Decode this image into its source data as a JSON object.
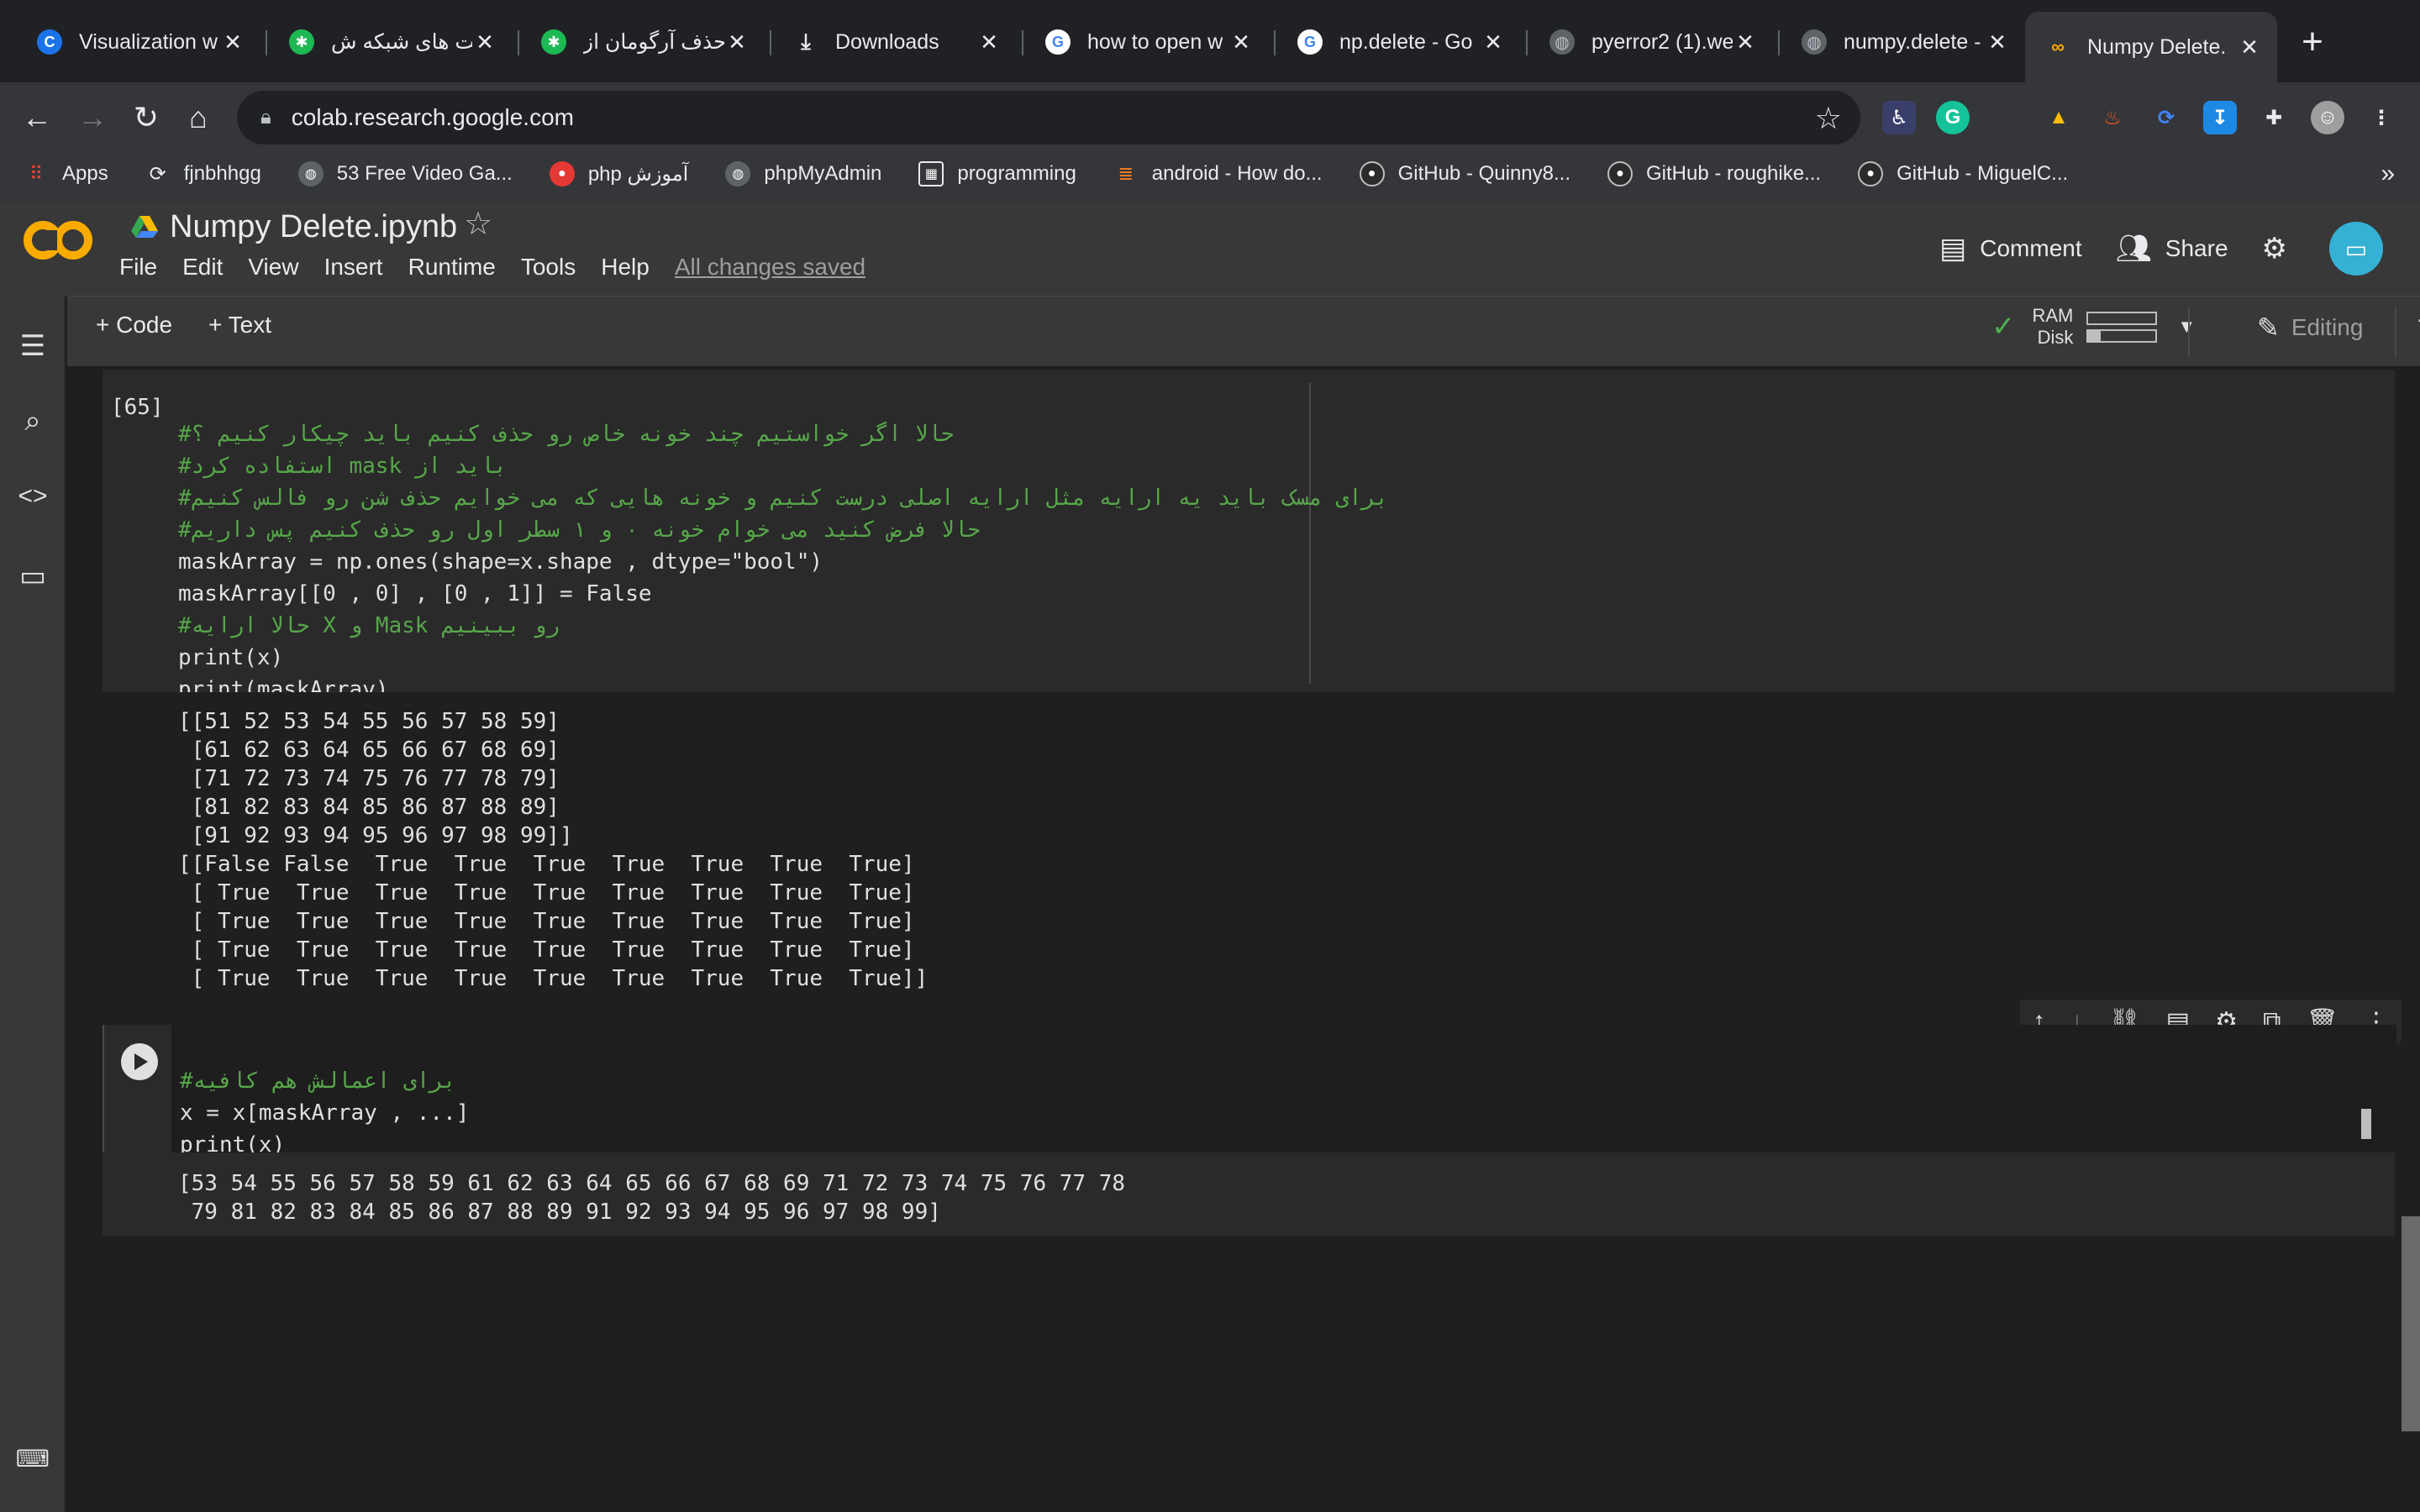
{
  "browser": {
    "tabs": [
      {
        "label": "Visualization w",
        "icon": "colab-c-icon",
        "color": "#1a73e8"
      },
      {
        "label": "فعالیت های شبکه ش",
        "icon": "green-flower-icon",
        "color": "#1db954"
      },
      {
        "label": "حذف آرگومان از py",
        "icon": "green-flower-icon",
        "color": "#1db954"
      },
      {
        "label": "Downloads",
        "icon": "download-icon",
        "color": "#e8eaed"
      },
      {
        "label": "how to open w",
        "icon": "google-g-icon",
        "color": "#ffffff"
      },
      {
        "label": "np.delete - Go",
        "icon": "google-g-icon",
        "color": "#ffffff"
      },
      {
        "label": "pyerror2 (1).we",
        "icon": "globe-icon",
        "color": "#9aa0a6"
      },
      {
        "label": "numpy.delete -",
        "icon": "globe-icon",
        "color": "#9aa0a6"
      },
      {
        "label": "Numpy Delete.",
        "icon": "colab-co-icon",
        "color": "#f9ab00",
        "active": true
      }
    ],
    "url": "colab.research.google.com",
    "bookmarks": [
      {
        "label": "Apps",
        "icon": "apps-grid-icon"
      },
      {
        "label": "fjnbhhgg",
        "icon": "github-icon"
      },
      {
        "label": "53 Free Video Ga...",
        "icon": "globe-icon"
      },
      {
        "label": "php آموزش",
        "icon": "tomato-icon"
      },
      {
        "label": "phpMyAdmin",
        "icon": "globe-icon"
      },
      {
        "label": "programming",
        "icon": "folder-icon"
      },
      {
        "label": "android - How do...",
        "icon": "stackoverflow-icon"
      },
      {
        "label": "GitHub - Quinny8...",
        "icon": "github-icon"
      },
      {
        "label": "GitHub - roughike...",
        "icon": "github-icon"
      },
      {
        "label": "GitHub - MiguelC...",
        "icon": "github-icon"
      }
    ],
    "bookmarks_more": "»"
  },
  "colab": {
    "logo": "CO",
    "title": "Numpy Delete.ipynb",
    "menus": [
      "File",
      "Edit",
      "View",
      "Insert",
      "Runtime",
      "Tools",
      "Help"
    ],
    "save_status": "All changes saved",
    "comment_label": "Comment",
    "share_label": "Share",
    "add_code": "+ Code",
    "add_text": "+ Text",
    "ram_label": "RAM",
    "disk_label": "Disk",
    "ram_usage": 0.0,
    "disk_usage": 0.18,
    "editing_label": "Editing"
  },
  "cells": {
    "cell1": {
      "exec_count": "[65]",
      "lines": [
        {
          "type": "comment",
          "text": "#حالا اگر خواستیم چند خونه خاص رو حذف کنیم باید چیکار کنیم ؟"
        },
        {
          "type": "comment",
          "text": "#استفاده کرد mask باید از"
        },
        {
          "type": "comment",
          "text": "#برای مسک باید یه ارایه مثل ارایه اصلی درست کنیم و خونه هایی که می خوایم حذف شن رو فالس کنیم"
        },
        {
          "type": "comment",
          "text": "#حالا فرض کنید می خوام خونه ۰ و ۱ سطر اول رو حذف کنیم پس داریم"
        },
        {
          "type": "code",
          "text": "maskArray = np.ones(shape=x.shape , dtype=\"bool\")"
        },
        {
          "type": "code",
          "text": "maskArray[[0 , 0] , [0 , 1]] = False"
        },
        {
          "type": "comment",
          "text": "#حالا ارایه X و Mask رو ببینیم"
        },
        {
          "type": "code",
          "text": "print(x)"
        },
        {
          "type": "code",
          "text": "print(maskArray)"
        }
      ],
      "output": "[[51 52 53 54 55 56 57 58 59]\n [61 62 63 64 65 66 67 68 69]\n [71 72 73 74 75 76 77 78 79]\n [81 82 83 84 85 86 87 88 89]\n [91 92 93 94 95 96 97 98 99]]\n[[False False  True  True  True  True  True  True  True]\n [ True  True  True  True  True  True  True  True  True]\n [ True  True  True  True  True  True  True  True  True]\n [ True  True  True  True  True  True  True  True  True]\n [ True  True  True  True  True  True  True  True  True]]"
    },
    "cell2": {
      "lines": [
        {
          "type": "comment",
          "text": "#برای اعمالش هم کافیه"
        },
        {
          "type": "code",
          "text": "x = x[maskArray , ...]"
        },
        {
          "type": "code",
          "text": "print(x)"
        }
      ],
      "output": "[53 54 55 56 57 58 59 61 62 63 64 65 66 67 68 69 71 72 73 74 75 76 77 78\n 79 81 82 83 84 85 86 87 88 89 91 92 93 94 95 96 97 98 99]"
    }
  }
}
